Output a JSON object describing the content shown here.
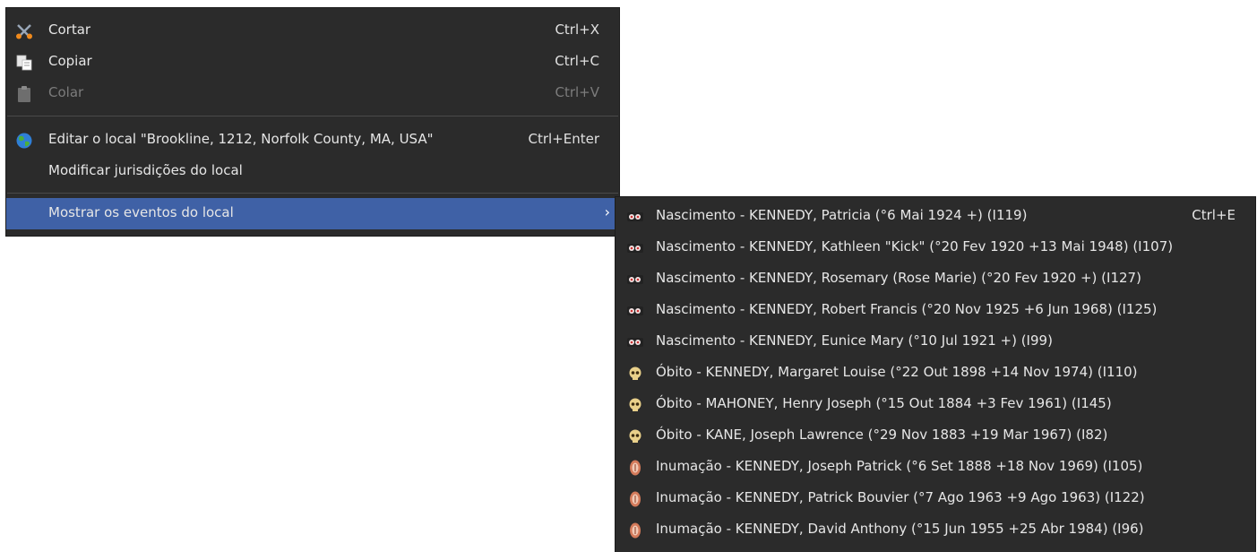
{
  "main_menu": {
    "items": [
      {
        "label": "Cortar",
        "shortcut": "Ctrl+X",
        "icon": "scissors-icon",
        "enabled": true
      },
      {
        "label": "Copiar",
        "shortcut": "Ctrl+C",
        "icon": "copy-icon",
        "enabled": true
      },
      {
        "label": "Colar",
        "shortcut": "Ctrl+V",
        "icon": "paste-icon",
        "enabled": false
      },
      {
        "label": "Editar o local \"Brookline, 1212, Norfolk County, MA, USA\"",
        "shortcut": "Ctrl+Enter",
        "icon": "globe-icon",
        "enabled": true
      },
      {
        "label": "Modificar jurisdições do local",
        "shortcut": "",
        "icon": "",
        "enabled": true
      },
      {
        "label": "Mostrar os eventos do local",
        "shortcut": "",
        "icon": "",
        "enabled": true,
        "submenu_arrow": "›"
      }
    ]
  },
  "submenu": {
    "items": [
      {
        "label": "Nascimento - KENNEDY, Patricia (°6 Mai 1924 +) (I119)",
        "shortcut": "Ctrl+E",
        "icon": "birth-icon"
      },
      {
        "label": "Nascimento - KENNEDY, Kathleen \"Kick\" (°20 Fev 1920 +13 Mai 1948) (I107)",
        "shortcut": "",
        "icon": "birth-icon"
      },
      {
        "label": "Nascimento - KENNEDY, Rosemary (Rose Marie) (°20 Fev 1920 +) (I127)",
        "shortcut": "",
        "icon": "birth-icon"
      },
      {
        "label": "Nascimento - KENNEDY, Robert Francis (°20 Nov 1925 +6 Jun 1968) (I125)",
        "shortcut": "",
        "icon": "birth-icon"
      },
      {
        "label": "Nascimento - KENNEDY, Eunice Mary (°10 Jul 1921 +) (I99)",
        "shortcut": "",
        "icon": "birth-icon"
      },
      {
        "label": "Óbito - KENNEDY, Margaret Louise (°22 Out 1898 +14 Nov 1974) (I110)",
        "shortcut": "",
        "icon": "skull-icon"
      },
      {
        "label": "Óbito - MAHONEY, Henry Joseph (°15 Out 1884 +3 Fev 1961) (I145)",
        "shortcut": "",
        "icon": "skull-icon"
      },
      {
        "label": "Óbito - KANE, Joseph Lawrence (°29 Nov 1883 +19 Mar 1967) (I82)",
        "shortcut": "",
        "icon": "skull-icon"
      },
      {
        "label": "Inumação - KENNEDY, Joseph Patrick (°6 Set 1888 +18 Nov 1969) (I105)",
        "shortcut": "",
        "icon": "burial-icon"
      },
      {
        "label": "Inumação - KENNEDY, Patrick Bouvier (°7 Ago 1963 +9 Ago 1963) (I122)",
        "shortcut": "",
        "icon": "burial-icon"
      },
      {
        "label": "Inumação - KENNEDY, David Anthony (°15 Jun 1955 +25 Abr 1984) (I96)",
        "shortcut": "",
        "icon": "burial-icon"
      }
    ]
  },
  "colors": {
    "menu_bg": "#2b2b2b",
    "highlight": "#3f61a6",
    "text": "#e6e6e6",
    "disabled_text": "#7c7c7c"
  }
}
